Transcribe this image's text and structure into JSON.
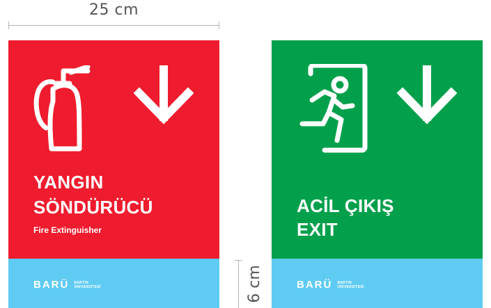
{
  "dimensions": {
    "width_label": "25 cm",
    "height_label": "6 cm"
  },
  "signs": [
    {
      "title_line1": "YANGIN",
      "title_line2": "SÖNDÜRÜCÜ",
      "subtitle": "Fire Extinguisher",
      "icon": "fire-extinguisher-icon",
      "arrow": "arrow-down-icon",
      "panel_color": "#ee1c2e",
      "footer_color": "#5fcbf3",
      "logo": {
        "word": "BARÜ",
        "line1": "BARTIN",
        "line2": "ÜNİVERSİTESİ"
      }
    },
    {
      "title_line1": "ACİL ÇIKIŞ",
      "title_line2": "EXIT",
      "icon": "emergency-exit-icon",
      "arrow": "arrow-down-icon",
      "panel_color": "#03a04b",
      "footer_color": "#5fcbf3",
      "logo": {
        "word": "BARÜ",
        "line1": "BARTIN",
        "line2": "ÜNİVERSİTESİ"
      }
    }
  ]
}
